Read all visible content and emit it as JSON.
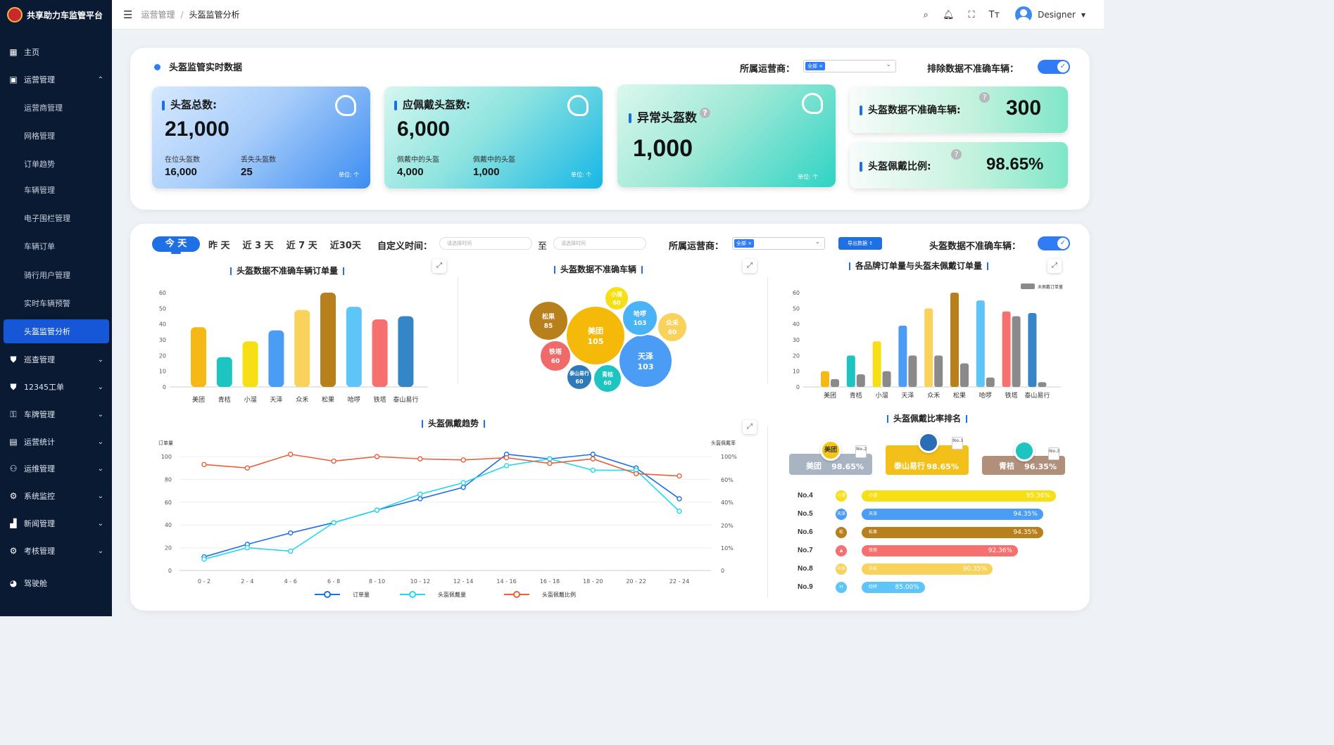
{
  "app": {
    "title": "共享助力车监管平台",
    "user": "Designer"
  },
  "breadcrumb": [
    "运营管理",
    "头盔监管分析"
  ],
  "sidebar": [
    {
      "label": "主页",
      "icon": "grid-icon",
      "level": "top",
      "y": 74
    },
    {
      "label": "运营管理",
      "icon": "monitor-icon",
      "level": "top",
      "y": 113,
      "chev": "^"
    },
    {
      "label": "运营商管理",
      "level": "sub",
      "y": 153
    },
    {
      "label": "网格管理",
      "level": "sub",
      "y": 193
    },
    {
      "label": "订单趋势",
      "level": "sub",
      "y": 233
    },
    {
      "label": "车辆管理",
      "level": "sub",
      "y": 270
    },
    {
      "label": "电子围栏管理",
      "level": "sub",
      "y": 310
    },
    {
      "label": "车辆订单",
      "level": "sub",
      "y": 350
    },
    {
      "label": "骑行用户管理",
      "level": "sub",
      "y": 391
    },
    {
      "label": "实时车辆预警",
      "level": "sub",
      "y": 431
    },
    {
      "label": "头盔监管分析",
      "level": "sub",
      "y": 471,
      "active": true
    },
    {
      "label": "巡查管理",
      "icon": "shield-icon",
      "level": "top",
      "y": 511,
      "chev": "⌄"
    },
    {
      "label": "12345工单",
      "icon": "shield-icon",
      "level": "top",
      "y": 550,
      "chev": "⌄"
    },
    {
      "label": "车牌管理",
      "icon": "lock-icon",
      "level": "top",
      "y": 589,
      "chev": "⌄"
    },
    {
      "label": "运营统计",
      "icon": "stats-icon",
      "level": "top",
      "y": 628,
      "chev": "⌄"
    },
    {
      "label": "运维管理",
      "icon": "user-gear-icon",
      "level": "top",
      "y": 666,
      "chev": "⌄"
    },
    {
      "label": "系统监控",
      "icon": "gear-icon",
      "level": "top",
      "y": 705,
      "chev": "⌄"
    },
    {
      "label": "新闻管理",
      "icon": "chart-icon",
      "level": "top",
      "y": 744,
      "chev": "⌄"
    },
    {
      "label": "考核管理",
      "icon": "gear-icon",
      "level": "top",
      "y": 783,
      "chev": "⌄"
    },
    {
      "label": "驾驶舱",
      "icon": "pie-icon",
      "level": "top",
      "y": 829
    }
  ],
  "realtime": {
    "title": "头盔监管实时数据",
    "operator_label": "所属运营商：",
    "operator_tag": "全部",
    "exclude_label": "排除数据不准确车辆：",
    "card1": {
      "title": "头盔总数:",
      "value": "21,000",
      "s1_label": "在位头盔数",
      "s1_value": "16,000",
      "s2_label": "丢失头盔数",
      "s2_value": "25",
      "unit": "单位: 个"
    },
    "card2": {
      "title": "应佩戴头盔数:",
      "value": "6,000",
      "s1_label": "佩戴中的头盔",
      "s1_value": "4,000",
      "s2_label": "佩戴中的头盔",
      "s2_value": "1,000",
      "unit": "单位: 个"
    },
    "card3": {
      "title": "异常头盔数",
      "value": "1,000",
      "unit": "单位: 个"
    },
    "card4": {
      "title": "头盔数据不准确车辆:",
      "value": "300"
    },
    "card5": {
      "title": "头盔佩戴比例:",
      "value": "98.65%"
    }
  },
  "filters": {
    "tabs": [
      "今 天",
      "昨 天",
      "近 3 天",
      "近 7 天",
      "近30天"
    ],
    "custom_label": "自定义时间：",
    "date_placeholder": "请选择时间",
    "to": "至",
    "operator_label": "所属运营商：",
    "operator_tag": "全部",
    "export": "导出数据",
    "inaccurate_label": "头盔数据不准确车辆："
  },
  "chart1": {
    "title": "头盔数据不准确车辆订单量",
    "type": "bar",
    "categories": [
      "美团",
      "青桔",
      "小溜",
      "天泽",
      "众禾",
      "松果",
      "哈啰",
      "铁塔",
      "泰山易行"
    ],
    "values": [
      38,
      19,
      29,
      36,
      49,
      60,
      51,
      43,
      45
    ],
    "colors": [
      "#f5b817",
      "#1ec5c0",
      "#f7df15",
      "#4a9cf5",
      "#f9d25c",
      "#b8801c",
      "#5dc5f7",
      "#f77070",
      "#3486c6"
    ],
    "yticks": [
      0,
      10,
      20,
      30,
      40,
      50,
      60
    ]
  },
  "chart2": {
    "title": "头盔数据不准确车辆",
    "type": "bubble",
    "bubbles": [
      {
        "name": "美团",
        "value": "105",
        "x": 846,
        "y": 477,
        "r": 42,
        "color": "#f5b90a"
      },
      {
        "name": "天泽",
        "value": "103",
        "x": 917,
        "y": 513,
        "r": 38,
        "color": "#4a9cf5"
      },
      {
        "name": "松果",
        "value": "85",
        "x": 779,
        "y": 456,
        "r": 28,
        "color": "#b8801c"
      },
      {
        "name": "哈啰",
        "value": "103",
        "x": 909,
        "y": 452,
        "r": 25,
        "color": "#4ab2f7"
      },
      {
        "name": "众禾",
        "value": "60",
        "x": 955,
        "y": 465,
        "r": 21,
        "color": "#f9d25c"
      },
      {
        "name": "小溜",
        "value": "60",
        "x": 876,
        "y": 424,
        "r": 17,
        "color": "#f7df15"
      },
      {
        "name": "铁塔",
        "value": "60",
        "x": 789,
        "y": 506,
        "r": 22,
        "color": "#f06a6a"
      },
      {
        "name": "青桔",
        "value": "60",
        "x": 863,
        "y": 538,
        "r": 20,
        "color": "#1ec5c0"
      },
      {
        "name": "泰山易行",
        "value": "60",
        "x": 823,
        "y": 536,
        "r": 18,
        "color": "#2c7bb8"
      }
    ]
  },
  "chart3": {
    "title": "各品牌订单量与头盔未佩戴订单量",
    "type": "bar",
    "legend": "未佩戴订单量",
    "categories": [
      "美团",
      "青桔",
      "小溜",
      "天泽",
      "众禾",
      "松果",
      "哈啰",
      "铁塔",
      "泰山易行"
    ],
    "series": [
      {
        "values": [
          10,
          20,
          29,
          39,
          50,
          60,
          55,
          48,
          47
        ]
      },
      {
        "name": "未佩戴订单量",
        "values": [
          5,
          8,
          10,
          20,
          20,
          15,
          6,
          45,
          3
        ]
      }
    ],
    "colors": [
      "#f5b817",
      "#1ec5c0",
      "#f7df15",
      "#4a9cf5",
      "#f9d25c",
      "#b8801c",
      "#5dc5f7",
      "#f77070",
      "#3486c6"
    ],
    "yticks": [
      0,
      10,
      20,
      30,
      40,
      50,
      60
    ]
  },
  "chart4": {
    "title": "头盔佩戴趋势",
    "type": "line",
    "ylabel_left": "订单量",
    "ylabel_right": "头盔佩戴率",
    "x": [
      "0 - 2",
      "2 - 4",
      "4 - 6",
      "6 - 8",
      "8 - 10",
      "10 - 12",
      "12 - 14",
      "14 - 16",
      "16 - 18",
      "18 - 20",
      "20 - 22",
      "22 - 24"
    ],
    "yticks_left": [
      0,
      20,
      40,
      60,
      80,
      100
    ],
    "yticks_right": [
      "0",
      "10%",
      "20%",
      "40%",
      "60%",
      "80%",
      "100%"
    ],
    "series": [
      {
        "name": "订单量",
        "color": "#1f6fe5",
        "values": [
          12,
          23,
          33,
          42,
          53,
          63,
          73,
          102,
          98,
          102,
          90,
          63
        ]
      },
      {
        "name": "头盔佩戴量",
        "color": "#25d8f0",
        "values": [
          10,
          20,
          17,
          42,
          53,
          67,
          77,
          92,
          98,
          88,
          88,
          52
        ]
      },
      {
        "name": "头盔佩戴比例",
        "color": "#e8603c",
        "values": [
          93,
          90,
          102,
          96,
          100,
          98,
          97,
          99,
          94,
          98,
          85,
          83
        ]
      }
    ]
  },
  "ranking": {
    "title": "头盔佩戴比率排名",
    "podium": [
      {
        "name": "美团",
        "value": "98.65%",
        "rank": "No.2",
        "color": "#a9b4c2",
        "logo": "美团",
        "logo_color": "#f5c518"
      },
      {
        "name": "泰山易行",
        "value": "98.65%",
        "rank": "No.1",
        "color": "#f2c018",
        "logo": "",
        "logo_color": "#2a6db5"
      },
      {
        "name": "青桔",
        "value": "96.35%",
        "rank": "No.3",
        "color": "#b08f7b",
        "logo": "",
        "logo_color": "#1ec5c0"
      }
    ],
    "list": [
      {
        "no": "No.4",
        "name": "小溜",
        "value": "95.36%",
        "pct": 95.36,
        "color": "#f7df15",
        "icon": "小溜"
      },
      {
        "no": "No.5",
        "name": "天泽",
        "value": "94.35%",
        "pct": 94.35,
        "color": "#4a9cf5",
        "icon": "天泽"
      },
      {
        "no": "No.6",
        "name": "松果",
        "value": "94.35%",
        "pct": 94.35,
        "color": "#b8801c",
        "icon": "松"
      },
      {
        "no": "No.7",
        "name": "铁塔",
        "value": "92.36%",
        "pct": 92.36,
        "color": "#f77070",
        "icon": "▲"
      },
      {
        "no": "No.8",
        "name": "众禾",
        "value": "90.35%",
        "pct": 90.35,
        "color": "#f9d25c",
        "icon": "众禾"
      },
      {
        "no": "No.9",
        "name": "哈啰",
        "value": "85.00%",
        "pct": 85.0,
        "color": "#5dc5f7",
        "icon": "H"
      }
    ]
  }
}
